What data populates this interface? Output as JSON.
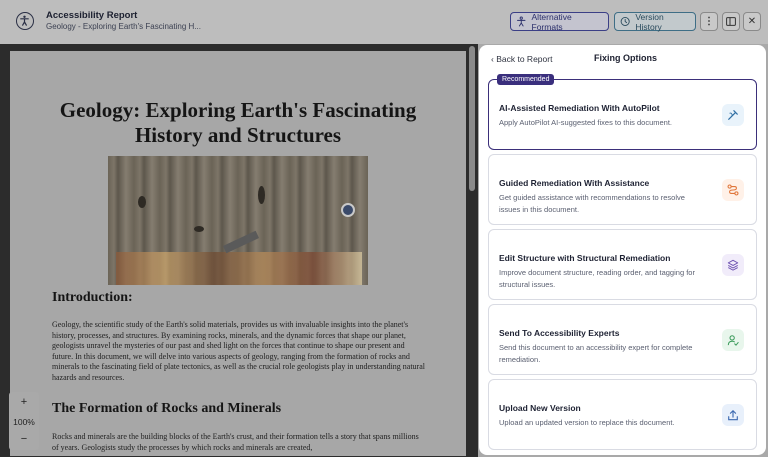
{
  "header": {
    "title": "Accessibility Report",
    "subtitle": "Geology - Exploring Earth's Fascinating H...",
    "alt_formats_label": "Alternative Formats",
    "version_history_label": "Version History"
  },
  "document": {
    "title_line1": "Geology: Exploring Earth's Fascinating",
    "title_line2": "History and Structures",
    "intro_heading": "Introduction:",
    "intro_text": "Geology, the scientific study of the Earth's solid materials, provides us with invaluable insights into the planet's history, processes, and structures. By examining rocks, minerals, and the dynamic forces that shape our planet, geologists unravel the mysteries of our past and shed light on the forces that continue to shape our present and future. In this document, we will delve into various aspects of geology, ranging from the formation of rocks and minerals to the fascinating field of plate tectonics, as well as the crucial role geologists play in understanding natural hazards and resources.",
    "section_heading": "The Formation of Rocks and Minerals",
    "section_text": "Rocks and minerals are the building blocks of the Earth's crust, and their formation tells a story that spans millions of years. Geologists study the processes by which rocks and minerals are created,"
  },
  "zoom": {
    "plus": "+",
    "level": "100%",
    "minus": "−"
  },
  "panel": {
    "back_label": "Back to Report",
    "title": "Fixing Options",
    "badge": "Recommended",
    "options": [
      {
        "title": "AI-Assisted Remediation With AutoPilot",
        "desc": "Apply AutoPilot AI-suggested fixes to this document."
      },
      {
        "title": "Guided Remediation With Assistance",
        "desc": "Get guided assistance with recommendations to resolve issues in this document."
      },
      {
        "title": "Edit Structure with Structural Remediation",
        "desc": "Improve document structure, reading order, and tagging for structural issues."
      },
      {
        "title": "Send To Accessibility Experts",
        "desc": "Send this document to an accessibility expert for complete remediation."
      },
      {
        "title": "Upload New Version",
        "desc": "Upload an updated version to replace this document."
      }
    ]
  },
  "icons": {
    "logo": "accessibility-icon",
    "alt_formats": "accessibility-icon",
    "version_history": "history-icon",
    "menu": "more-vertical-icon",
    "layout": "panel-layout-icon",
    "close": "close-icon",
    "option_icons": [
      "wand-icon",
      "route-icon",
      "layers-icon",
      "expert-user-icon",
      "upload-icon"
    ]
  },
  "colors": {
    "accent": "#3b2f7a",
    "option_icon_bg": [
      "#e9f3fb",
      "#fff1e8",
      "#f1ecfa",
      "#e8f6ec",
      "#e8f0fb"
    ],
    "option_icon_fg": [
      "#2f6ea3",
      "#e0763a",
      "#6b4fb0",
      "#3a9a5a",
      "#3a68b0"
    ]
  }
}
